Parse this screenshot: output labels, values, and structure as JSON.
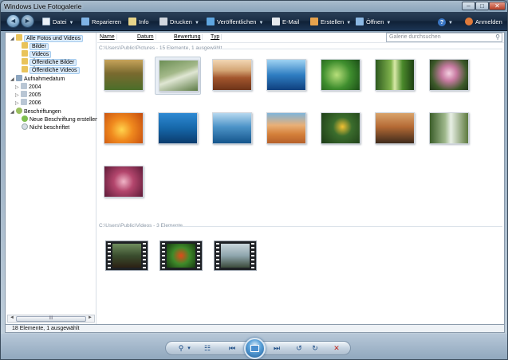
{
  "window": {
    "title": "Windows Live Fotogalerie"
  },
  "caption": {
    "minimize": "–",
    "maximize": "□",
    "close": "✕"
  },
  "nav": {
    "back_glyph": "◄",
    "forward_glyph": "►"
  },
  "toolbar": {
    "items": [
      {
        "label": "Datei",
        "icon": "file-icon",
        "color": "#eaf1f8",
        "dropdown": true
      },
      {
        "label": "Reparieren",
        "icon": "repair-icon",
        "color": "#7fb3e5",
        "dropdown": false
      },
      {
        "label": "Info",
        "icon": "info-tag-icon",
        "color": "#e8d58a",
        "dropdown": false
      },
      {
        "label": "Drucken",
        "icon": "printer-icon",
        "color": "#d0d6de",
        "dropdown": true
      },
      {
        "label": "Veröffentlichen",
        "icon": "publish-icon",
        "color": "#5fa6e0",
        "dropdown": true
      },
      {
        "label": "E-Mail",
        "icon": "email-icon",
        "color": "#e5e9ee",
        "dropdown": false
      },
      {
        "label": "Erstellen",
        "icon": "create-icon",
        "color": "#e6a24d",
        "dropdown": true
      },
      {
        "label": "Öffnen",
        "icon": "open-icon",
        "color": "#8cb8e3",
        "dropdown": true
      }
    ],
    "help_label": "?",
    "signin_label": "Anmelden"
  },
  "columns": [
    "Name",
    "Datum",
    "Bewertung",
    "Typ"
  ],
  "search": {
    "placeholder": "Galerie durchsuchen"
  },
  "sidebar": {
    "all": "Alle Fotos und Videos",
    "pictures": "Bilder",
    "videos": "Videos",
    "public_pictures": "Öffentliche Bilder",
    "public_videos": "Öffentliche Videos",
    "date_taken": "Aufnahmedatum",
    "years": [
      "2004",
      "2005",
      "2006"
    ],
    "tags": "Beschriftungen",
    "new_tag": "Neue Beschriftung erstellen",
    "untagged": "Nicht beschriftet",
    "scroll_thumb_glyph": "III"
  },
  "groups": {
    "pictures": "C:\\Users\\Public\\Pictures - 15 Elemente, 1 ausgewählt",
    "videos": "C:\\Users\\Public\\Videos - 3 Elemente"
  },
  "photos": [
    {
      "name": "photo-autumn-tree",
      "bg": "linear-gradient(180deg,#c7a35a 0,#7a6a2f 45%,#4b6e2a 100%)",
      "selected": false
    },
    {
      "name": "photo-creek",
      "bg": "linear-gradient(160deg,#6c8f55 0,#a4b98a 40%,#dfe6d3 55%,#5c7a44 100%)",
      "selected": true
    },
    {
      "name": "photo-desert-rocks",
      "bg": "linear-gradient(180deg,#f2d7b5 0,#d4a676 35%,#a2552d 60%,#6d3419 100%)",
      "selected": false
    },
    {
      "name": "photo-blue-landscape",
      "bg": "linear-gradient(180deg,#9fd3f2 0,#2f7ec2 50%,#0f3f7e 100%)",
      "selected": false
    },
    {
      "name": "photo-green-leaves",
      "bg": "radial-gradient(circle at 40% 50%,#b7df7a 0,#3f8e2e 50%,#1b4d17 100%)",
      "selected": false
    },
    {
      "name": "photo-forest",
      "bg": "linear-gradient(90deg,#2e5a1f 0,#7fb24c 40%,#d8e9a7 50%,#4b8a2b 70%,#1e4014 100%)",
      "selected": false
    },
    {
      "name": "photo-pink-flowers",
      "bg": "radial-gradient(circle at 50% 45%,#f3cfe0 0,#c77aa1 30%,#3d5a2a 70%,#1f3517 100%)",
      "selected": false
    },
    {
      "name": "photo-orange-flowers",
      "bg": "radial-gradient(circle at 45% 55%,#ffd34d 0,#f08a1e 40%,#c44a0e 100%)",
      "selected": false
    },
    {
      "name": "photo-sea-turtle",
      "bg": "linear-gradient(180deg,#2f8ad3 0,#1667a9 50%,#0b3b6d 100%)",
      "selected": false
    },
    {
      "name": "photo-whale-tail",
      "bg": "linear-gradient(180deg,#b6d8ef 0,#4d94c8 45%,#13548b 100%)",
      "selected": false
    },
    {
      "name": "photo-sand-dunes",
      "bg": "linear-gradient(180deg,#7fb4da 0,#e9b077 40%,#d47f3a 70%,#b5602a 100%)",
      "selected": false
    },
    {
      "name": "photo-toucan",
      "bg": "radial-gradient(circle at 55% 45%,#f2c133 0,#3b6d2d 35%,#1c3a16 100%)",
      "selected": false
    },
    {
      "name": "photo-sunset-tree",
      "bg": "linear-gradient(180deg,#d9a36b 0,#b56a35 45%,#3e2a1c 100%)",
      "selected": false
    },
    {
      "name": "photo-waterfall",
      "bg": "linear-gradient(90deg,#3b5e2a 0,#9fb88c 40%,#e8efe5 55%,#5d7a3e 100%)",
      "selected": false
    },
    {
      "name": "photo-coral",
      "bg": "radial-gradient(circle at 50% 50%,#f0b5c7 0,#b4466d 40%,#5e1b38 100%)",
      "selected": false
    }
  ],
  "videos": [
    {
      "name": "video-bear",
      "bg": "linear-gradient(180deg,#6f8e5e 0,#3a4d2e 50%,#2c2014 100%)"
    },
    {
      "name": "video-butterfly",
      "bg": "radial-gradient(circle at 50% 50%,#e24a1a 0,#3f8a2a 45%,#163a10 100%)"
    },
    {
      "name": "video-lake",
      "bg": "linear-gradient(180deg,#c9d6dc 0,#8ea5ad 50%,#3c4b3b 100%)"
    }
  ],
  "status": {
    "text": "18 Elemente, 1 ausgewählt"
  },
  "dock": {
    "zoom_glyph": "⚲",
    "zoom_dropdown": "▾",
    "view_glyph": "☷",
    "prev_glyph": "⏮",
    "next_glyph": "⏭",
    "rotate_ccw_glyph": "↺",
    "rotate_cw_glyph": "↻",
    "delete_glyph": "✕"
  }
}
